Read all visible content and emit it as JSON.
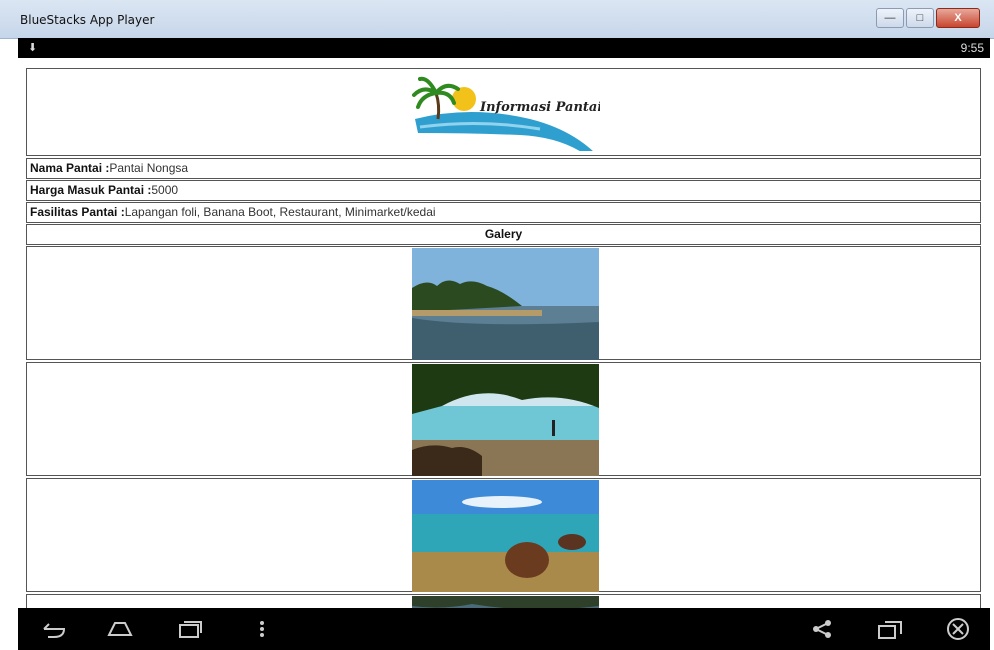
{
  "window": {
    "title": "BlueStacks App Player",
    "min_symbol": "—",
    "max_symbol": "□",
    "close_symbol": "X"
  },
  "statusbar": {
    "time": "9:55",
    "download_symbol": "⬇"
  },
  "app": {
    "logo_text": "Informasi Pantai",
    "nama_label": "Nama Pantai :",
    "nama_value": "Pantai Nongsa",
    "harga_label": "Harga Masuk Pantai :",
    "harga_value": "5000",
    "fasilitas_label": "Fasilitas Pantai :",
    "fasilitas_value": "Lapangan foli, Banana Boot, Restaurant, Minimarket/kedai",
    "gallery_header": "Galery"
  },
  "navbar": {
    "icons": [
      "back-icon",
      "home-icon",
      "recent-apps-icon",
      "menu-icon",
      "share-icon",
      "rotate-icon",
      "close-icon"
    ]
  },
  "colors": {
    "title_bar": "#c6d6ea",
    "nav_bg": "#000000",
    "sea": "#2f9fd0"
  }
}
